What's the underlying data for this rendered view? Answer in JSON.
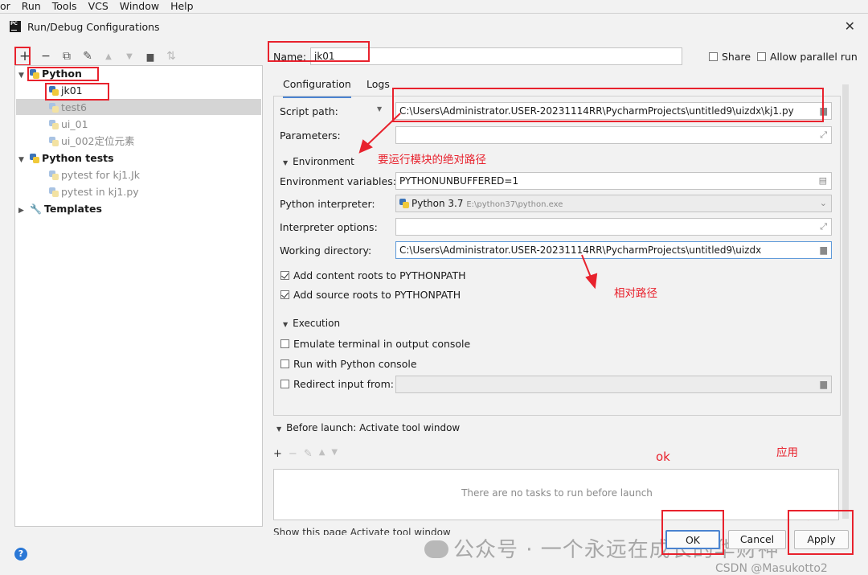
{
  "menu": [
    "or",
    "Run",
    "Tools",
    "VCS",
    "Window",
    "Help"
  ],
  "dialog": {
    "title": "Run/Debug Configurations",
    "close": "✕"
  },
  "toolbar": [
    {
      "name": "add",
      "glyph": "+"
    },
    {
      "name": "remove",
      "glyph": "−"
    },
    {
      "name": "copy",
      "glyph": "⧉"
    },
    {
      "name": "edit-defaults",
      "glyph": "✎"
    },
    {
      "name": "move-up",
      "glyph": "▲"
    },
    {
      "name": "move-down",
      "glyph": "▼"
    },
    {
      "name": "folder",
      "glyph": "▆"
    },
    {
      "name": "sort",
      "glyph": "⇅"
    }
  ],
  "tree": {
    "python": "Python",
    "jk01": "jk01",
    "test6": "test6",
    "ui_01": "ui_01",
    "ui_002": "ui_002定位元素",
    "python_tests": "Python tests",
    "pytest_kj1Jk": "pytest for kj1.Jk",
    "pytest_kj1py": "pytest in kj1.py",
    "templates": "Templates"
  },
  "name_field": {
    "label": "Name:",
    "value": "jk01"
  },
  "share": {
    "label": "Share",
    "checked": false
  },
  "parallel": {
    "label": "Allow parallel run",
    "checked": false
  },
  "tabs": [
    "Configuration",
    "Logs"
  ],
  "form": {
    "script_path_label": "Script path:",
    "script_path": "C:\\Users\\Administrator.USER-20231114RR\\PycharmProjects\\untitled9\\uizdx\\kj1.py",
    "parameters_label": "Parameters:",
    "parameters": "",
    "environment_section": "Environment",
    "env_vars_label": "Environment variables:",
    "env_vars": "PYTHONUNBUFFERED=1",
    "interpreter_label": "Python interpreter:",
    "interpreter_name": "Python 3.7",
    "interpreter_path": "E:\\python37\\python.exe",
    "interp_options_label": "Interpreter options:",
    "interp_options": "",
    "working_dir_label": "Working directory:",
    "working_dir": "C:\\Users\\Administrator.USER-20231114RR\\PycharmProjects\\untitled9\\uizdx",
    "add_content_roots": "Add content roots to PYTHONPATH",
    "add_source_roots": "Add source roots to PYTHONPATH",
    "execution_section": "Execution",
    "emulate_terminal": "Emulate terminal in output console",
    "run_with_console": "Run with Python console",
    "redirect_input": "Redirect input from:"
  },
  "before_launch": {
    "title": "Before launch: Activate tool window",
    "empty": "There are no tasks to run before launch",
    "bottom_partial": "Show this page   Activate tool window"
  },
  "buttons": {
    "ok": "OK",
    "cancel": "Cancel",
    "apply": "Apply"
  },
  "annotations": {
    "abs_path": "要运行模块的绝对路径",
    "rel_path": "相对路径",
    "ok": "ok",
    "apply": "应用"
  },
  "watermark": {
    "text": "公众号 · 一个永远在成长的华财神",
    "csdn": "CSDN @Masukotto2"
  },
  "colors": {
    "accent": "#4a83d0",
    "annotation": "#e8222d"
  }
}
